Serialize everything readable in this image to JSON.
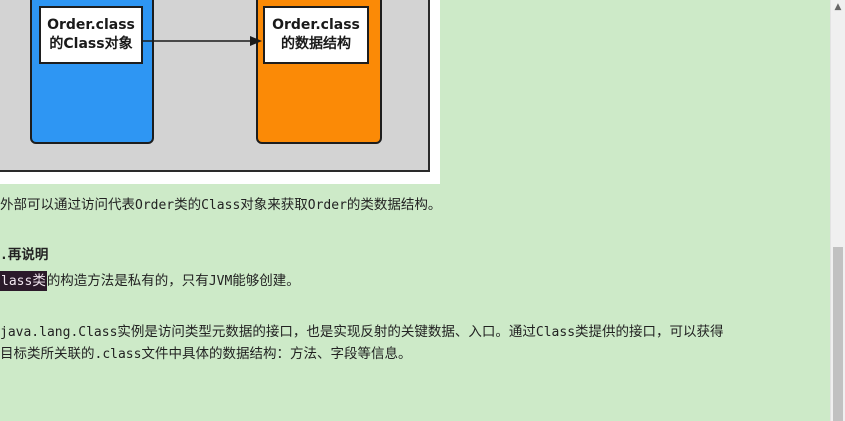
{
  "diagram": {
    "left_box": {
      "line1": "Order.class",
      "line2": "的Class对象"
    },
    "right_box": {
      "line1": "Order.class",
      "line2": "的数据结构"
    }
  },
  "content": {
    "line1_a": "外部可以通过访问代表",
    "line1_b": "Order",
    "line1_c": "类的",
    "line1_d": "Class",
    "line1_e": "对象来获取",
    "line1_f": "Order",
    "line1_g": "的类数据结构。",
    "heading_prefix": ".",
    "heading_text": "再说明",
    "line2_highlight_a": "lass",
    "line2_highlight_b": "类",
    "line2_a": "的构造方法是私有的，只有",
    "line2_b": "JVM",
    "line2_c": "能够创建。",
    "line3_a": "java.lang.Class",
    "line3_b": "实例是访问类型元数据的接口，也是实现反射的关键数据、入口。通过",
    "line3_c": "Class",
    "line3_d": "类提供的接口，可以获得",
    "line4_a": "目标类所关联的",
    "line4_b": ".class",
    "line4_c": "文件中具体的数据结构：方法、字段等信息。"
  },
  "scrollbar": {
    "up_glyph": "▲",
    "position": 0.59
  }
}
